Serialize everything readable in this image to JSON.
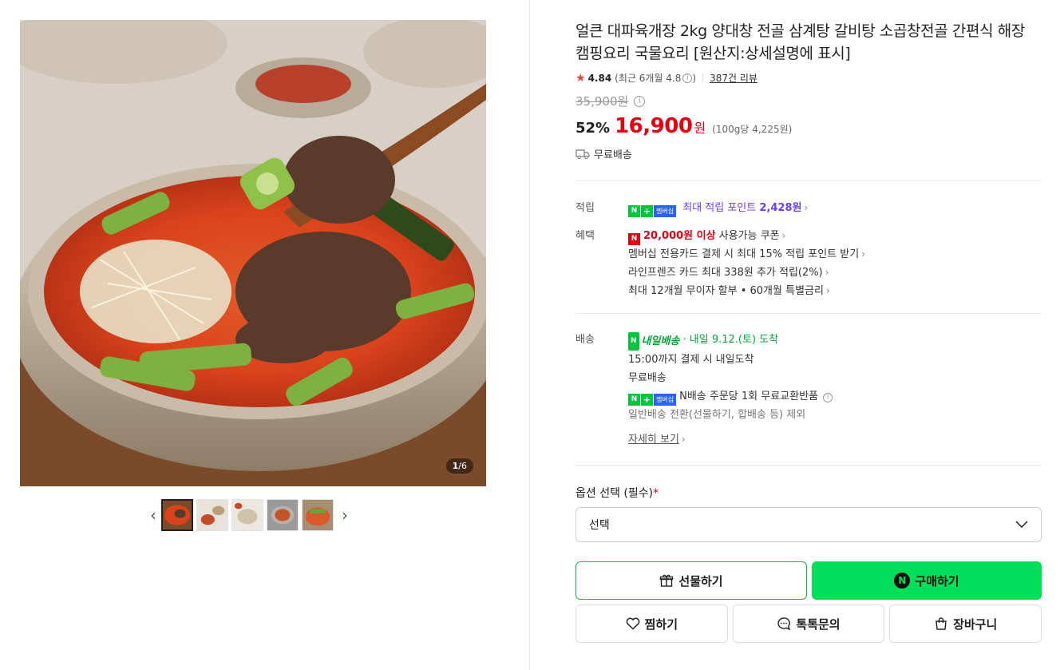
{
  "product": {
    "title": "얼큰 대파육개장 2kg 양대창 전골 삼계탕 갈비탕 소곱창전골 간편식 해장 캠핑요리 국물요리 [원산지:상세설명에 표시]",
    "image_counter_current": "1",
    "image_counter_total": "/6",
    "rating": "4.84",
    "rating_recent": "(최근 6개월 4.8",
    "rating_recent_close": ")",
    "review_count": "387건 리뷰",
    "original_price": "35,900원",
    "discount_rate": "52%",
    "price": "16,900",
    "price_unit": "원",
    "unit_price": "(100g당 4,225원)",
    "shipping_label": "무료배송"
  },
  "points": {
    "label": "적립",
    "badge_n": "N",
    "badge_plus": "+",
    "badge_membership": "멤버십",
    "text": "최대 적립 포인트",
    "amount": "2,428원"
  },
  "benefits": {
    "label": "혜택",
    "coupon_amount": "20,000원 이상",
    "coupon_text": "사용가능 쿠폰",
    "line2": "멤버십 전용카드 결제 시 최대 15% 적립 포인트 받기",
    "line3": "라인프렌즈 카드 최대 338원 추가 적립(2%)",
    "line4": "최대 12개월 무이자 할부 • 60개월 특별금리"
  },
  "delivery": {
    "label": "배송",
    "tomorrow_badge": "내일배송",
    "arrival": "· 내일 9.12.(토) 도착",
    "cutoff": "15:00까지 결제 시 내일도착",
    "free": "무료배송",
    "nship": "N배송 주문당 1회 무료교환반품",
    "exclude": "일반배송 전환(선물하기, 합배송 등) 제외",
    "more": "자세히 보기"
  },
  "option": {
    "label": "옵션 선택 (필수)",
    "required_mark": "*",
    "selected": "선택"
  },
  "buttons": {
    "gift": "선물하기",
    "buy": "구매하기",
    "wish": "찜하기",
    "talk": "톡톡문의",
    "cart": "장바구니"
  },
  "colors": {
    "accent_green": "#00de5a",
    "price_red": "#e60012",
    "membership_purple": "#6a3cff"
  }
}
